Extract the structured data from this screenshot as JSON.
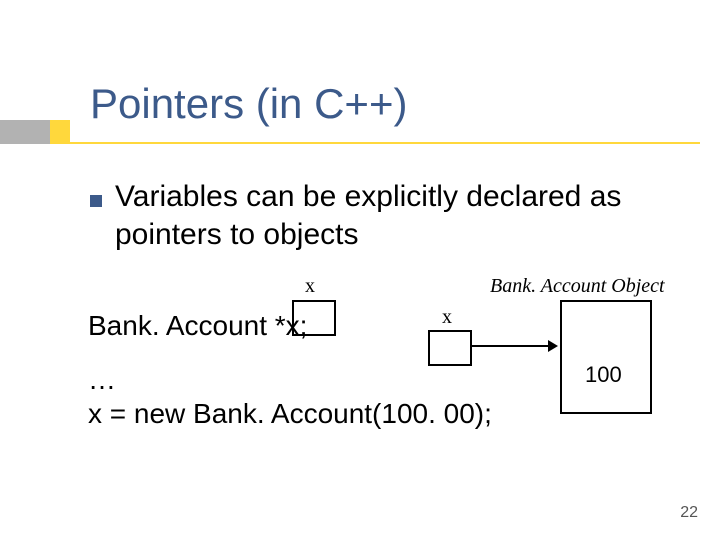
{
  "title": "Pointers (in C++)",
  "bullet": "Variables can be explicitly declared as pointers to objects",
  "code": {
    "line1": "Bank. Account *x;",
    "line2": "…",
    "line3": "x = new Bank. Account(100. 00);"
  },
  "diagram": {
    "x_label_1": "x",
    "x_label_2": "x",
    "object_label": "Bank. Account Object",
    "object_value": "100"
  },
  "page_number": "22"
}
